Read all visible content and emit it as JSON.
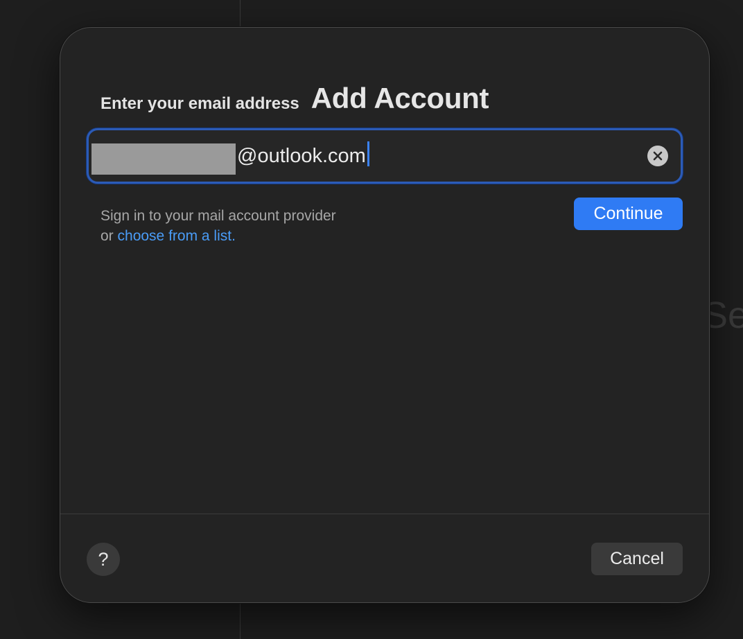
{
  "background": {
    "ghost_text": "Se"
  },
  "dialog": {
    "title": "Add Account",
    "subtitle": "Enter your email address",
    "email_field": {
      "value": "@outlook.com"
    },
    "hint": {
      "line1": "Sign in to your mail account provider",
      "line2_prefix": "or ",
      "link": "choose from a list."
    },
    "continue_label": "Continue",
    "help_label": "?",
    "cancel_label": "Cancel",
    "colors": {
      "accent": "#2f7bf4",
      "link": "#4a9cf7",
      "focus_ring": "#2c5bb6"
    }
  }
}
